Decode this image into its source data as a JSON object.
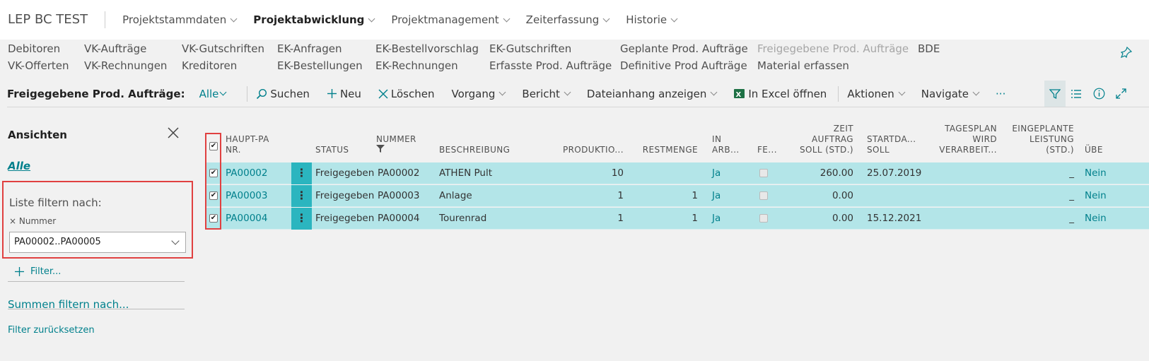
{
  "app": {
    "company": "LEP BC TEST"
  },
  "nav": [
    {
      "label": "Projektstammdaten",
      "active": false
    },
    {
      "label": "Projektabwicklung",
      "active": true
    },
    {
      "label": "Projektmanagement",
      "active": false
    },
    {
      "label": "Zeiterfassung",
      "active": false
    },
    {
      "label": "Historie",
      "active": false
    }
  ],
  "links": [
    [
      "Debitoren",
      "VK-Offerten"
    ],
    [
      "VK-Aufträge",
      "VK-Rechnungen"
    ],
    [
      "VK-Gutschriften",
      "Kreditoren"
    ],
    [
      "EK-Anfragen",
      "EK-Bestellungen"
    ],
    [
      "EK-Bestellvorschlag",
      "EK-Rechnungen"
    ],
    [
      "EK-Gutschriften",
      "Erfasste Prod. Aufträge"
    ],
    [
      "Geplante Prod. Aufträge",
      "Definitive Prod Aufträge"
    ],
    [
      "Freigegebene Prod. Aufträge",
      "Material erfassen"
    ],
    [
      "BDE",
      ""
    ]
  ],
  "actionbar": {
    "title": "Freigegebene Prod. Aufträge:",
    "view": "Alle",
    "search": "Suchen",
    "new": "Neu",
    "delete": "Löschen",
    "vorgang": "Vorgang",
    "bericht": "Bericht",
    "attach": "Dateianhang anzeigen",
    "excel": "In Excel öffnen",
    "aktionen": "Aktionen",
    "navigate": "Navigate",
    "more": "···"
  },
  "panel": {
    "title": "Ansichten",
    "view_all": "Alle",
    "filter_label": "Liste filtern nach:",
    "filter_field": "Nummer",
    "filter_value": "PA00002..PA00005",
    "add_filter": "Filter...",
    "sum_filter": "Summen filtern nach...",
    "reset": "Filter zurücksetzen"
  },
  "columns": {
    "haupt": "HAUPT-PA\nNR.",
    "status": "STATUS",
    "nummer": "NUMMER",
    "beschreibung": "BESCHREIBUNG",
    "produktion": "PRODUKTIO...",
    "restmenge": "RESTMENGE",
    "inarb": "IN\nARB...",
    "fe": "FE...",
    "zeit": "ZEIT\nAUFTRAG\nSOLL (STD.)",
    "start": "STARTDA...\nSOLL",
    "tagesplan": "TAGESPLAN\nWIRD\nVERARBEIT...",
    "eingeplante": "EINGEPLANTE\nLEISTUNG\n(STD.)",
    "ube": "ÜBE"
  },
  "rows": [
    {
      "haupt": "PA00002",
      "status": "Freigegeben",
      "nummer": "PA00002",
      "beschreibung": "ATHEN Pult",
      "produktion": "10",
      "restmenge": "",
      "inarb": "Ja",
      "zeit": "260.00",
      "start": "25.07.2019",
      "eingeplante": "_",
      "ube": "Nein"
    },
    {
      "haupt": "PA00003",
      "status": "Freigegeben",
      "nummer": "PA00003",
      "beschreibung": "Anlage",
      "produktion": "1",
      "restmenge": "1",
      "inarb": "Ja",
      "zeit": "0.00",
      "start": "",
      "eingeplante": "_",
      "ube": "Nein"
    },
    {
      "haupt": "PA00004",
      "status": "Freigegeben",
      "nummer": "PA00004",
      "beschreibung": "Tourenrad",
      "produktion": "1",
      "restmenge": "1",
      "inarb": "Ja",
      "zeit": "0.00",
      "start": "15.12.2021",
      "eingeplante": "_",
      "ube": "Nein"
    }
  ]
}
